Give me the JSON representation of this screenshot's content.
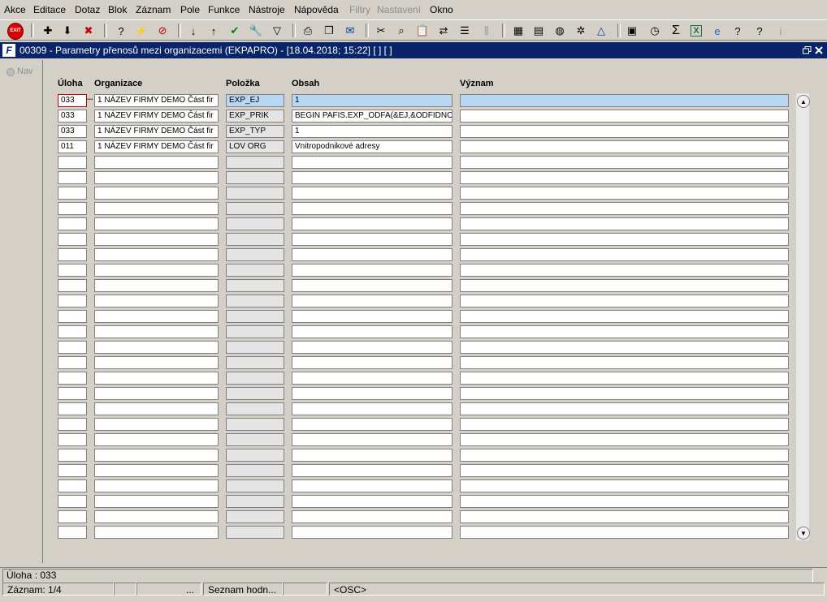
{
  "menu": [
    "Akce",
    "Editace",
    "Dotaz",
    "Blok",
    "Záznam",
    "Pole",
    "Funkce",
    "Nástroje",
    "Nápověda",
    "Filtry",
    "Nastavení",
    "Okno"
  ],
  "menu_disabled": [
    "Filtry",
    "Nastavení"
  ],
  "toolbar": {
    "exit_label": "EXIT",
    "icons": [
      "new-record-icon",
      "save-icon",
      "delete-record-icon",
      "query-enter-icon",
      "query-execute-icon",
      "query-cancel-icon",
      "sort-asc-icon",
      "sort-desc-icon",
      "commit-icon",
      "tools-icon",
      "filter-icon",
      "print-icon",
      "copy-icon",
      "mail-icon",
      "cut-icon",
      "find-icon",
      "paste-icon",
      "replace-icon",
      "list-icon",
      "columns-icon",
      "calculator-icon",
      "document-icon",
      "globe-icon",
      "settings-icon",
      "tent-icon",
      "certificate-icon",
      "clock-icon",
      "sigma-icon",
      "excel-icon",
      "browser-icon",
      "help-query-icon",
      "help-icon",
      "info-icon"
    ]
  },
  "window": {
    "title": "00309 - Parametry přenosů mezi organizacemi (EKPAPRO) - [18.04.2018; 15:22]  [ ]  [ ]",
    "nav_label": "Nav"
  },
  "columns": {
    "uloha": "Úloha",
    "organizace": "Organizace",
    "polozka": "Položka",
    "obsah": "Obsah",
    "vyznam": "Význam"
  },
  "rows": [
    {
      "uloha": "033",
      "organizace": "1 NÁZEV FIRMY DEMO Část fir",
      "polozka": "EXP_EJ",
      "obsah": "1",
      "vyznam": ""
    },
    {
      "uloha": "033",
      "organizace": "1 NÁZEV FIRMY DEMO Část fir",
      "polozka": "EXP_PRIK",
      "obsah": "BEGIN PAFIS.EXP_ODFA(&EJ,&ODFIDNO",
      "vyznam": ""
    },
    {
      "uloha": "033",
      "organizace": "1 NÁZEV FIRMY DEMO Část fir",
      "polozka": "EXP_TYP",
      "obsah": "1",
      "vyznam": ""
    },
    {
      "uloha": "011",
      "organizace": "1 NÁZEV FIRMY DEMO Část fir",
      "polozka": "LOV ORG",
      "obsah": "Vnitropodnikové adresy",
      "vyznam": ""
    }
  ],
  "list_indicator": "...",
  "status": {
    "field_info": "Úloha : 033",
    "record": "Záznam: 1/4",
    "ellipsis": "...",
    "list_hint": "Seznam hodn...",
    "osc": "<OSC>"
  },
  "colors": {
    "titlebar": "#0a246a",
    "selected_row": "#b9d6f2",
    "focus_border": "#c00000"
  }
}
